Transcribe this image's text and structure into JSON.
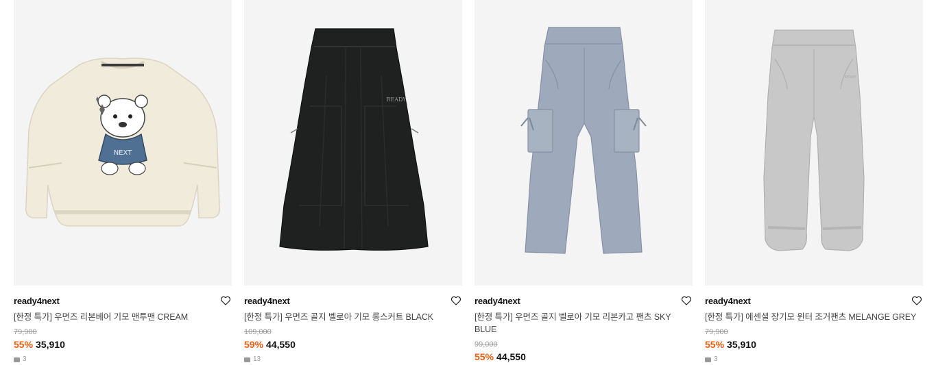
{
  "products": [
    {
      "brand": "ready4next",
      "name": "[한정 특가] 우먼즈 리본베어 기모 맨투맨 CREAM",
      "original_price": "79,900",
      "discount": "55%",
      "price": "35,910",
      "review_count": "3",
      "image": "cream-bear-sweatshirt"
    },
    {
      "brand": "ready4next",
      "name": "[한정 특가] 우먼즈 골지 벨로아 기모 롱스커트 BLACK",
      "original_price": "109,000",
      "discount": "59%",
      "price": "44,550",
      "review_count": "13",
      "image": "black-velour-long-skirt"
    },
    {
      "brand": "ready4next",
      "name": "[한정 특가] 우먼즈 골지 벨로아 기모 리본카고 팬츠 SKY BLUE",
      "original_price": "99,000",
      "discount": "55%",
      "price": "44,550",
      "review_count": "",
      "image": "sky-blue-cargo-pants"
    },
    {
      "brand": "ready4next",
      "name": "[한정 특가] 에센셜 장기모 윈터 조거팬츠 MELANGE GREY",
      "original_price": "79,900",
      "discount": "55%",
      "price": "35,910",
      "review_count": "3",
      "image": "melange-grey-jogger-pants"
    }
  ],
  "colors": {
    "discount": "#f25c0f",
    "thumb_bg": "#f4f4f4",
    "cream": "#f1ebdc",
    "black": "#1f2020",
    "sky_blue": "#9eaabb",
    "grey": "#c8c8c8"
  }
}
